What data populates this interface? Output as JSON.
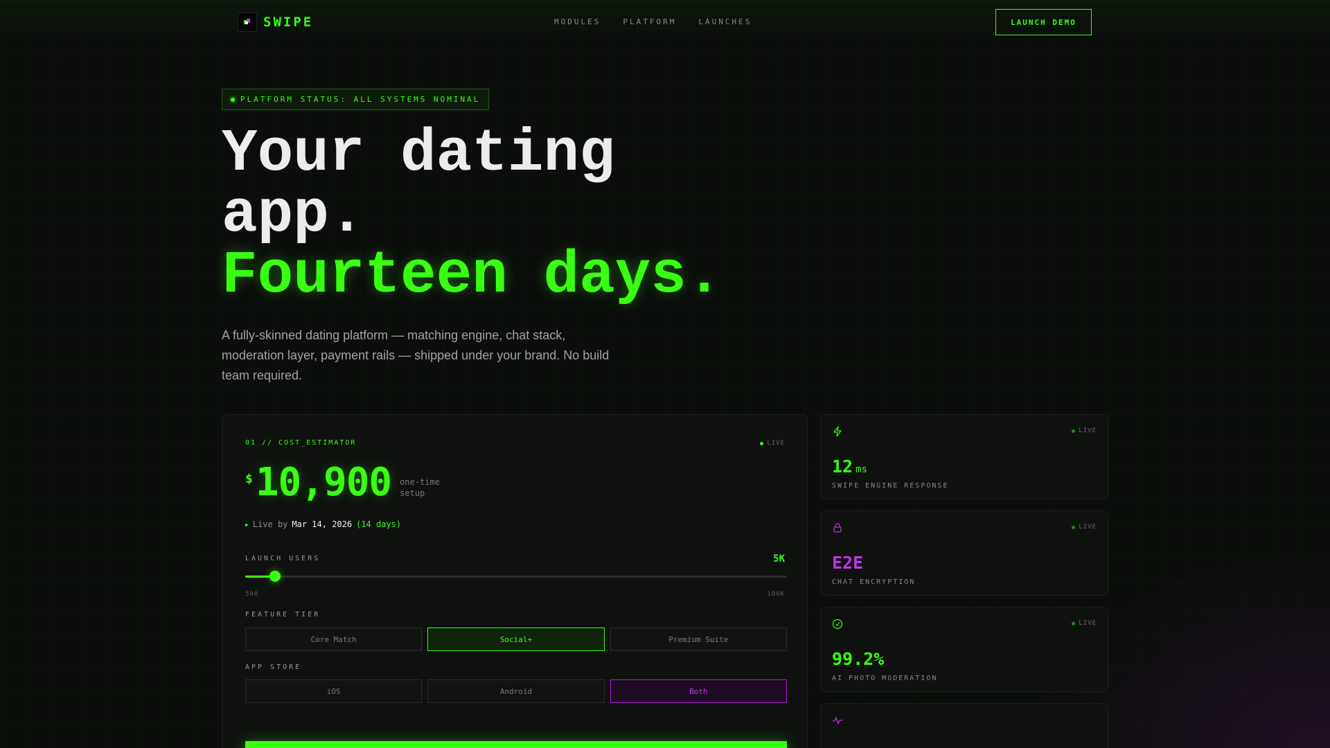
{
  "nav": {
    "brand": "SWIPE",
    "links": [
      "MODULES",
      "PLATFORM",
      "LAUNCHES"
    ],
    "cta": "LAUNCH DEMO"
  },
  "hero": {
    "status": "PLATFORM STATUS: ALL SYSTEMS NOMINAL",
    "headline_line1": "Your dating app.",
    "headline_line2": "Fourteen days.",
    "subtitle": "A fully-skinned dating platform — matching engine, chat stack, moderation layer, payment rails — shipped under your brand. No build team required."
  },
  "estimator": {
    "label": "01 // COST_ESTIMATOR",
    "live": "LIVE",
    "currency": "$",
    "amount": "10,900",
    "amount_note": "one-time setup",
    "live_by_prefix": "Live by",
    "live_date": "Mar 14, 2026",
    "live_days": "(14 days)",
    "users": {
      "label": "LAUNCH USERS",
      "value": "5K",
      "min_label": "500",
      "max_label": "100K",
      "fraction": 0.055
    },
    "tier": {
      "label": "FEATURE TIER",
      "options": [
        "Core Match",
        "Social+",
        "Premium Suite"
      ],
      "selected": "Social+"
    },
    "store": {
      "label": "APP STORE",
      "options": [
        "iOS",
        "Android",
        "Both"
      ],
      "selected": "Both"
    }
  },
  "stats": [
    {
      "icon": "bolt-icon",
      "live": "LIVE",
      "value": "12",
      "unit": "ms",
      "caption": "SWIPE ENGINE RESPONSE",
      "color": "#39ff14"
    },
    {
      "icon": "lock-icon",
      "live": "LIVE",
      "value": "E2E",
      "unit": "",
      "caption": "CHAT ENCRYPTION",
      "color": "#c235e6"
    },
    {
      "icon": "check-circle-icon",
      "live": "LIVE",
      "value": "99.2%",
      "unit": "",
      "caption": "AI PHOTO MODERATION",
      "color": "#39ff14"
    },
    {
      "icon": "pulse-icon",
      "live": "",
      "value": "",
      "unit": "",
      "caption": "",
      "color": "#c235e6"
    }
  ],
  "colors": {
    "accent": "#39ff14",
    "secondary": "#c235e6",
    "background": "#0b0d0b"
  }
}
